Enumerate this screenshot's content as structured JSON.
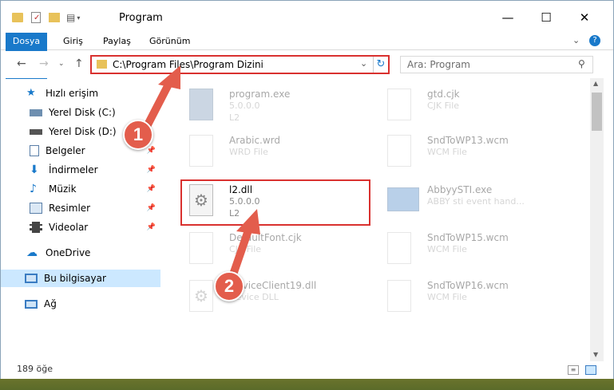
{
  "window": {
    "title": "Program",
    "controls": {
      "minimize": "—",
      "maximize": "☐",
      "close": "✕"
    }
  },
  "ribbon": {
    "tabs": [
      {
        "label": "Dosya"
      },
      {
        "label": "Giriş"
      },
      {
        "label": "Paylaş"
      },
      {
        "label": "Görünüm"
      }
    ]
  },
  "address": {
    "path": "C:\\Program Files\\Program Dizini",
    "search_placeholder": "Ara: Program"
  },
  "sidebar": {
    "items": [
      {
        "label": "Hızlı erişim"
      },
      {
        "label": "Yerel Disk (C:)"
      },
      {
        "label": "Yerel Disk (D:)"
      },
      {
        "label": "Belgeler"
      },
      {
        "label": "İndirmeler"
      },
      {
        "label": "Müzik"
      },
      {
        "label": "Resimler"
      },
      {
        "label": "Videolar"
      },
      {
        "label": "OneDrive"
      },
      {
        "label": "Bu bilgisayar"
      },
      {
        "label": "Ağ"
      }
    ]
  },
  "files": {
    "left": [
      {
        "name": "program.exe",
        "version": "5.0.0.0",
        "desc": "L2"
      },
      {
        "name": "Arabic.wrd",
        "desc": "WRD File"
      },
      {
        "name": "l2.dll",
        "version": "5.0.0.0",
        "desc": "L2"
      },
      {
        "name": "DefaultFont.cjk",
        "desc": "CJK File"
      },
      {
        "name": "DeviceClient19.dll",
        "desc": "Device DLL"
      }
    ],
    "right": [
      {
        "name": "gtd.cjk",
        "desc": "CJK File"
      },
      {
        "name": "SndToWP13.wcm",
        "desc": "WCM File"
      },
      {
        "name": "AbbyySTI.exe",
        "desc": "ABBY sti event hand..."
      },
      {
        "name": "SndToWP15.wcm",
        "desc": "WCM File"
      },
      {
        "name": "SndToWP16.wcm",
        "desc": "WCM File"
      }
    ]
  },
  "status": {
    "count": "189 öğe"
  },
  "markers": {
    "one": "1",
    "two": "2"
  },
  "colors": {
    "accent": "#1979ca",
    "highlight": "#d9312f",
    "marker": "#e35d4c"
  }
}
